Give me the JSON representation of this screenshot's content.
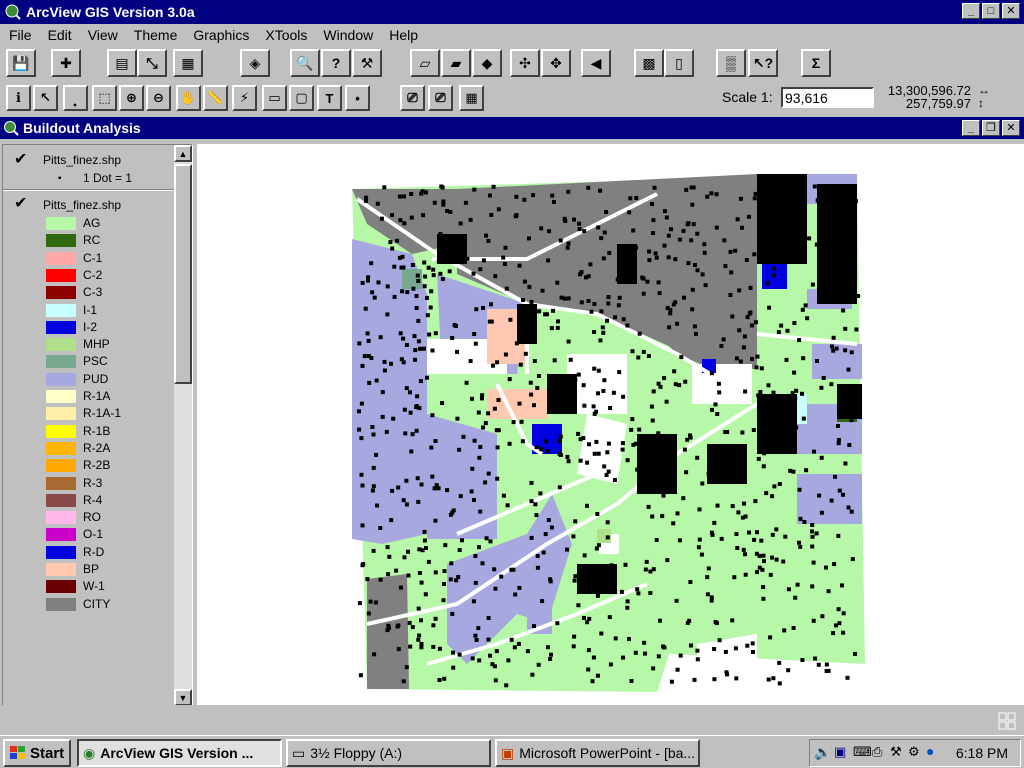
{
  "app": {
    "title": "ArcView GIS Version 3.0a",
    "icon": "arcview-globe-icon"
  },
  "menu": [
    "File",
    "Edit",
    "View",
    "Theme",
    "Graphics",
    "XTools",
    "Window",
    "Help"
  ],
  "toolbar1": [
    {
      "name": "save-project-button",
      "glyph": "💾"
    },
    {
      "name": "add-theme-button",
      "glyph": "✚"
    },
    {
      "name": "theme-properties-button",
      "glyph": "▤"
    },
    {
      "name": "edit-legend-button",
      "glyph": "⤡"
    },
    {
      "name": "open-theme-table-button",
      "glyph": "▦"
    },
    {
      "name": "locate-address-button",
      "glyph": "◈"
    },
    {
      "name": "find-button",
      "glyph": "🔍"
    },
    {
      "name": "query-builder-button",
      "glyph": "?"
    },
    {
      "name": "hammer-button",
      "glyph": "⚒"
    },
    {
      "name": "select-all-button",
      "glyph": "▱"
    },
    {
      "name": "clear-selected-button",
      "glyph": "▰"
    },
    {
      "name": "zoom-to-active-button",
      "glyph": "◆"
    },
    {
      "name": "zoom-to-full-extent-button",
      "glyph": "✣"
    },
    {
      "name": "zoom-to-selected-button",
      "glyph": "✥"
    },
    {
      "name": "zoom-previous-button",
      "glyph": "◀"
    },
    {
      "name": "layout-button",
      "glyph": "▩"
    },
    {
      "name": "page-button",
      "glyph": "▯"
    },
    {
      "name": "map-grid-button",
      "glyph": "▒"
    },
    {
      "name": "help-button",
      "glyph": "↖?"
    },
    {
      "name": "summarize-button",
      "glyph": "Σ"
    }
  ],
  "toolbar2": [
    {
      "name": "identify-tool",
      "glyph": "ℹ"
    },
    {
      "name": "pointer-tool",
      "glyph": "↖"
    },
    {
      "name": "vertex-edit-tool",
      "glyph": "⸼"
    },
    {
      "name": "select-feature-tool",
      "glyph": "⬚"
    },
    {
      "name": "zoom-in-tool",
      "glyph": "⊕"
    },
    {
      "name": "zoom-out-tool",
      "glyph": "⊖"
    },
    {
      "name": "pan-tool",
      "glyph": "✋"
    },
    {
      "name": "measure-tool",
      "glyph": "📏"
    },
    {
      "name": "hotlink-tool",
      "glyph": "⚡"
    },
    {
      "name": "label-tool",
      "glyph": "▭"
    },
    {
      "name": "text-label-tool",
      "glyph": "▢"
    },
    {
      "name": "text-tool",
      "glyph": "T"
    },
    {
      "name": "draw-point-tool",
      "glyph": "•"
    },
    {
      "name": "graphics-tool-1",
      "glyph": "⎚"
    },
    {
      "name": "graphics-tool-2",
      "glyph": "⎚"
    },
    {
      "name": "graphics-tool-3",
      "glyph": "▦"
    }
  ],
  "scale": {
    "label": "Scale 1:",
    "value": "93,616"
  },
  "coords": {
    "x": "13,300,596.72",
    "y": "257,759.97"
  },
  "view": {
    "title": "Buildout Analysis"
  },
  "themes": [
    {
      "name": "Pitts_finez.shp",
      "legend": [
        {
          "label": "1 Dot = 1",
          "color": "#000000",
          "dot": true
        }
      ]
    },
    {
      "name": "Pitts_finez.shp",
      "legend": [
        {
          "label": "AG",
          "color": "#b6f7a8"
        },
        {
          "label": "RC",
          "color": "#2f6a10"
        },
        {
          "label": "C-1",
          "color": "#ffa8a8"
        },
        {
          "label": "C-2",
          "color": "#ff0000"
        },
        {
          "label": "C-3",
          "color": "#8b0000"
        },
        {
          "label": "I-1",
          "color": "#c8ffff"
        },
        {
          "label": "I-2",
          "color": "#0000e0"
        },
        {
          "label": "MHP",
          "color": "#b0e08a"
        },
        {
          "label": "PSC",
          "color": "#79a890"
        },
        {
          "label": "PUD",
          "color": "#a8a8e0"
        },
        {
          "label": "R-1A",
          "color": "#ffffc8"
        },
        {
          "label": "R-1A-1",
          "color": "#fff0a8"
        },
        {
          "label": "R-1B",
          "color": "#ffff00"
        },
        {
          "label": "R-2A",
          "color": "#ffb400"
        },
        {
          "label": "R-2B",
          "color": "#ffa800"
        },
        {
          "label": "R-3",
          "color": "#a86a30"
        },
        {
          "label": "R-4",
          "color": "#8b4a4a"
        },
        {
          "label": "RO",
          "color": "#ffb8e8"
        },
        {
          "label": "O-1",
          "color": "#c800c8"
        },
        {
          "label": "R-D",
          "color": "#0000e0"
        },
        {
          "label": "BP",
          "color": "#ffc8b0"
        },
        {
          "label": "W-1",
          "color": "#6a0000"
        },
        {
          "label": "CITY",
          "color": "#808080"
        }
      ]
    }
  ],
  "taskbar": {
    "start": "Start",
    "tasks": [
      {
        "label": "ArcView GIS Version ...",
        "active": true,
        "icon": "arcview-globe-icon"
      },
      {
        "label": "3½ Floppy (A:)",
        "active": false,
        "icon": "floppy-drive-icon"
      },
      {
        "label": "Microsoft PowerPoint - [ba...",
        "active": false,
        "icon": "powerpoint-icon"
      }
    ],
    "clock": "6:18 PM"
  }
}
